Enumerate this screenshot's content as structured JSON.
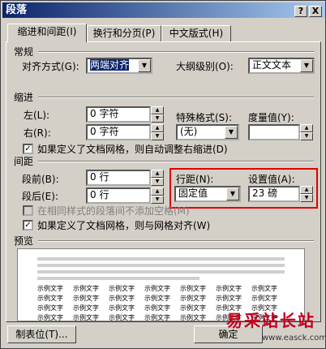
{
  "window": {
    "title": "段落",
    "help_button": "?",
    "close_button": "X"
  },
  "tabs": [
    {
      "label": "缩进和间距(I)"
    },
    {
      "label": "换行和分页(P)"
    },
    {
      "label": "中文版式(H)"
    }
  ],
  "general": {
    "heading": "常规",
    "alignment_label": "对齐方式(G):",
    "alignment_value": "两端对齐",
    "outline_label": "大纲级别(O):",
    "outline_value": "正文文本"
  },
  "indent": {
    "heading": "缩进",
    "left_label": "左(L):",
    "left_value": "0 字符",
    "right_label": "右(R):",
    "right_value": "0 字符",
    "special_label": "特殊格式(S):",
    "special_value": "(无)",
    "measure_label": "度量值(Y):",
    "measure_value": "",
    "auto_adjust_label": "如果定义了文档网格，则自动调整右缩进(D)",
    "auto_adjust_checked": true
  },
  "spacing": {
    "heading": "间距",
    "before_label": "段前(B):",
    "before_value": "0 行",
    "after_label": "段后(E):",
    "after_value": "0 行",
    "line_spacing_label": "行距(N):",
    "line_spacing_value": "固定值",
    "setting_label": "设置值(A):",
    "setting_value": "23 磅",
    "no_space_same_style_label": "在相同样式的段落间不添加空格(M)",
    "no_space_same_style_checked": false,
    "snap_grid_label": "如果定义了文档网格，则与网格对齐(W)",
    "snap_grid_checked": true
  },
  "preview": {
    "heading": "预览",
    "sample_text": "示例文字"
  },
  "buttons": {
    "tabs": "制表位(T)...",
    "ok": "确定"
  },
  "watermark": {
    "text": "易采站长站",
    "url": "www.easck.com"
  },
  "colors": {
    "title_start": "#0a246a",
    "highlight_box": "#e00000",
    "watermark": "#c00020"
  }
}
